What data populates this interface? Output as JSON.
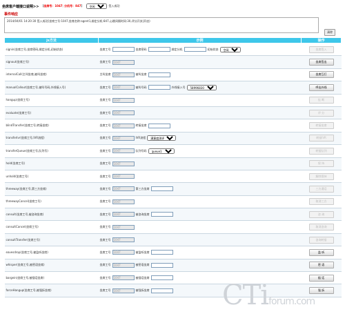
{
  "header": {
    "title": "坐席客户端接口说明>>",
    "status_prefix": "【",
    "status_agent": "坐席号：1047",
    "status_ext": "分机号：847",
    "status_suffix": "】",
    "state_select": "空闲",
    "after_text": "签入成功"
  },
  "event": {
    "title": "事件响应"
  },
  "log": {
    "line": "2014/04/01 14:20:30  签入成功[坐席工号:1047,坐席名称:agent1,绑定分机:847,心跳间隔时间:30,评分开关(开启)"
  },
  "clear_button": "清除",
  "table": {
    "headers": [
      "js方法",
      "示例",
      "操作"
    ],
    "rows": [
      {
        "method": "signin(坐席工号,坐席密码,绑定分机,初始状态)",
        "params": [
          {
            "type": "input",
            "label": "坐席工号",
            "value": ""
          },
          {
            "type": "input",
            "label": "坐席密码",
            "value": ""
          },
          {
            "type": "input",
            "label": "绑定分机",
            "value": ""
          },
          {
            "type": "select",
            "label": "初始状态",
            "value": "空闲"
          }
        ],
        "button": "坐席签入",
        "enabled": false
      },
      {
        "method": "signout(坐席工号)",
        "params": [
          {
            "type": "input",
            "label": "坐席工号",
            "value": "1047",
            "readonly": true
          }
        ],
        "button": "坐席签出",
        "enabled": true
      },
      {
        "method": "internalCall(主叫坐席,被叫坐席)",
        "params": [
          {
            "type": "input",
            "label": "主叫坐席",
            "value": "1047",
            "readonly": true
          },
          {
            "type": "input",
            "label": "被叫坐席",
            "value": ""
          }
        ],
        "button": "坐席互打",
        "enabled": true
      },
      {
        "method": "manualCallout(坐席工号,被叫号码,外线接入号)",
        "params": [
          {
            "type": "input",
            "label": "坐席工号",
            "value": "1047",
            "readonly": true
          },
          {
            "type": "input",
            "label": "被叫号码",
            "value": ""
          },
          {
            "type": "select",
            "label": "外线接入号",
            "value": "58996830"
          }
        ],
        "button": "呼出外线",
        "enabled": true
      },
      {
        "method": "hangup(坐席工号)",
        "params": [
          {
            "type": "input",
            "label": "坐席工号",
            "value": "1047",
            "readonly": true
          }
        ],
        "button": "挂 断",
        "enabled": false
      },
      {
        "method": "evaluate(坐席工号)",
        "params": [
          {
            "type": "input",
            "label": "坐席工号",
            "value": "1047",
            "readonly": true
          }
        ],
        "button": "评 分",
        "enabled": false
      },
      {
        "method": "blindTransfer(坐席工号,转接坐席)",
        "params": [
          {
            "type": "input",
            "label": "坐席工号",
            "value": "1047",
            "readonly": true
          },
          {
            "type": "input",
            "label": "转接坐席",
            "value": ""
          }
        ],
        "button": "转接坐席",
        "enabled": false
      },
      {
        "method": "transferIvr(坐席工号,IVR流程)",
        "params": [
          {
            "type": "input",
            "label": "坐席工号",
            "value": "1047",
            "readonly": true
          },
          {
            "type": "select",
            "label": "IVR流程",
            "value": "满意度测评"
          }
        ],
        "button": "转接IVR",
        "enabled": false
      },
      {
        "method": "transferQueue(坐席工号,队列号)",
        "params": [
          {
            "type": "input",
            "label": "坐席工号",
            "value": "1047",
            "readonly": true
          },
          {
            "type": "select",
            "label": "队列号码",
            "value": "queue1"
          }
        ],
        "button": "转接队列",
        "enabled": false
      },
      {
        "method": "hold(坐席工号)",
        "params": [
          {
            "type": "input",
            "label": "坐席工号",
            "value": "1047",
            "readonly": true
          }
        ],
        "button": "保 持",
        "enabled": false
      },
      {
        "method": "unhold(坐席工号)",
        "params": [
          {
            "type": "input",
            "label": "坐席工号",
            "value": "1047",
            "readonly": true
          }
        ],
        "button": "解除保持",
        "enabled": false
      },
      {
        "method": "threeway(坐席工号,第三方坐席)",
        "params": [
          {
            "type": "input",
            "label": "坐席工号",
            "value": "1047",
            "readonly": true
          },
          {
            "type": "input",
            "label": "第三方坐席",
            "value": ""
          }
        ],
        "button": "三方通话",
        "enabled": false
      },
      {
        "method": "threewayCancel(坐席工号)",
        "params": [
          {
            "type": "input",
            "label": "坐席工号",
            "value": "1047",
            "readonly": true
          }
        ],
        "button": "取消三方",
        "enabled": false
      },
      {
        "method": "consult(坐席工号,被咨询坐席)",
        "params": [
          {
            "type": "input",
            "label": "坐席工号",
            "value": "1047",
            "readonly": true
          },
          {
            "type": "input",
            "label": "被咨询坐席",
            "value": ""
          }
        ],
        "button": "咨 询",
        "enabled": false
      },
      {
        "method": "consultCancel(坐席工号)",
        "params": [
          {
            "type": "input",
            "label": "坐席工号",
            "value": "1047",
            "readonly": true
          }
        ],
        "button": "取消咨询",
        "enabled": false
      },
      {
        "method": "consultTransfer(坐席工号)",
        "params": [
          {
            "type": "input",
            "label": "坐席工号",
            "value": "1047",
            "readonly": true
          }
        ],
        "button": "咨询转接",
        "enabled": false
      },
      {
        "method": "eavesdrop(坐席工号,被监听坐席)",
        "params": [
          {
            "type": "input",
            "label": "坐席工号",
            "value": "1047",
            "readonly": true
          },
          {
            "type": "input",
            "label": "被监听坐席",
            "value": ""
          }
        ],
        "button": "监 听",
        "enabled": true
      },
      {
        "method": "whisper(坐席工号,被密语坐席)",
        "params": [
          {
            "type": "input",
            "label": "坐席工号",
            "value": "1047",
            "readonly": true
          },
          {
            "type": "input",
            "label": "被密语坐席",
            "value": ""
          }
        ],
        "button": "密 语",
        "enabled": true
      },
      {
        "method": "bargein(坐席工号,被插话坐席)",
        "params": [
          {
            "type": "input",
            "label": "坐席工号",
            "value": "1047",
            "readonly": true
          },
          {
            "type": "input",
            "label": "被插话坐席",
            "value": ""
          }
        ],
        "button": "插 话",
        "enabled": true
      },
      {
        "method": "forceHangup(坐席工号,被强拆坐席)",
        "params": [
          {
            "type": "input",
            "label": "坐席工号",
            "value": "1047",
            "readonly": true
          },
          {
            "type": "input",
            "label": "被强拆坐席",
            "value": ""
          }
        ],
        "button": "强 拆",
        "enabled": true
      }
    ]
  },
  "watermark": {
    "main": "CTi",
    "sub": "forum.com"
  },
  "colors": {
    "header_bg": "#3ec7ea",
    "event_title": "#cc0000",
    "status_highlight": "#ee0000"
  }
}
